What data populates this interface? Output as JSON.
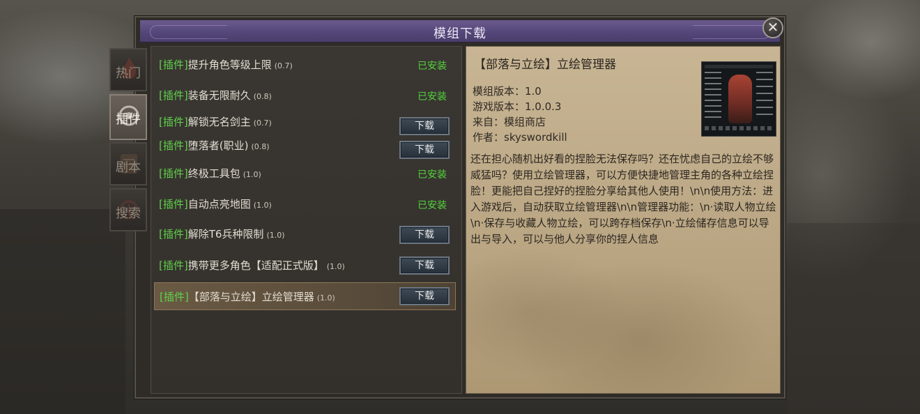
{
  "dialog": {
    "title": "模组下载",
    "close_glyph": "✕"
  },
  "tabs": [
    {
      "label": "热门",
      "icon": "flame-emblem-icon",
      "active": false
    },
    {
      "label": "插件",
      "icon": "gear-emblem-icon",
      "active": true
    },
    {
      "label": "剧本",
      "icon": "scroll-emblem-icon",
      "active": false
    },
    {
      "label": "搜索",
      "icon": "compass-emblem-icon",
      "active": false
    }
  ],
  "mods": [
    {
      "tag": "[插件]",
      "name": "提升角色等级上限",
      "version": "(0.7)",
      "state": "已安装"
    },
    {
      "tag": "[插件]",
      "name": "装备无限耐久",
      "version": "(0.8)",
      "state": "已安装"
    },
    {
      "tag": "[插件]",
      "name": "解锁无名剑主",
      "version": "(0.7)",
      "state": "下载"
    },
    {
      "tag": "[插件]",
      "name": "堕落者(职业)",
      "version": "(0.8)",
      "state": "下载"
    },
    {
      "tag": "[插件]",
      "name": "终极工具包",
      "version": "(1.0)",
      "state": "已安装"
    },
    {
      "tag": "[插件]",
      "name": "自动点亮地图",
      "version": "(1.0)",
      "state": "已安装"
    },
    {
      "tag": "[插件]",
      "name": "解除T6兵种限制",
      "version": "(1.0)",
      "state": "下载"
    },
    {
      "tag": "[插件]",
      "name": "携带更多角色【适配正式版】",
      "version": "(1.0)",
      "state": "下载"
    },
    {
      "tag": "[插件]",
      "name": "【部落与立绘】立绘管理器",
      "version": "(1.0)",
      "state": "下载",
      "selected": true
    }
  ],
  "detail": {
    "title": "【部落与立绘】立绘管理器",
    "mod_version": "模组版本：1.0",
    "game_version": "游戏版本：1.0.0.3",
    "source": "来自：模组商店",
    "author": "作者：skyswordkill",
    "description": "还在担心随机出好看的捏脸无法保存吗？还在忧虑自己的立绘不够威猛吗？使用立绘管理器，可以方便快捷地管理主角的各种立绘捏脸！更能把自己捏好的捏脸分享给其他人使用！\\n\\n使用方法：进入游戏后，自动获取立绘管理器\\n\\n管理器功能：\\n·读取人物立绘\\n·保存与收藏人物立绘，可以跨存档保存\\n·立绘储存信息可以导出与导入，可以与他人分享你的捏人信息"
  }
}
